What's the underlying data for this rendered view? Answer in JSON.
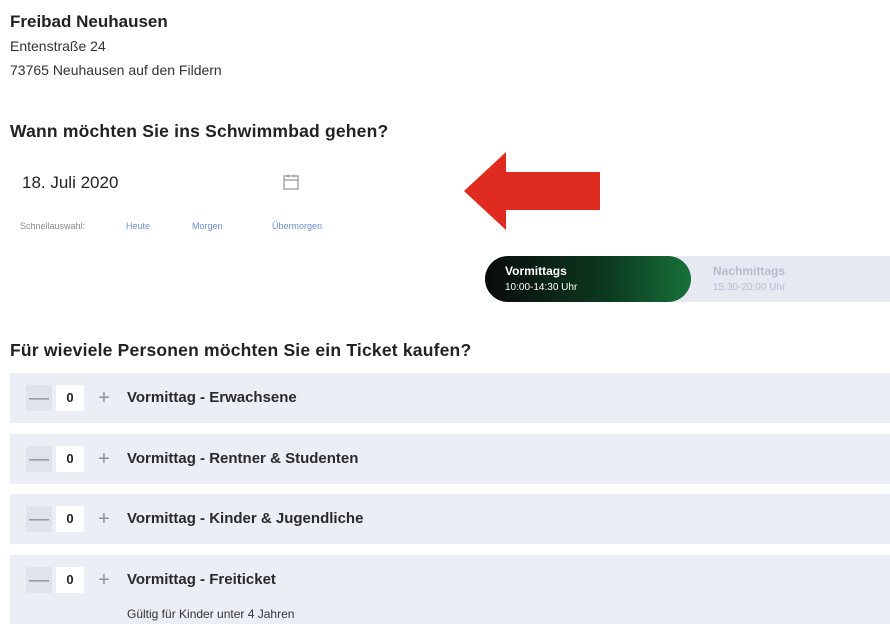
{
  "venue": {
    "name": "Freibad Neuhausen",
    "street": "Entenstraße 24",
    "city": "73765 Neuhausen auf den Fildern"
  },
  "date_section": {
    "question": "Wann möchten Sie ins Schwimmbad gehen?",
    "date_value": "18. Juli 2020",
    "icon": "calendar-icon",
    "quick_select_label": "Schnellauswahl:",
    "quick_options": [
      "Heute",
      "Morgen",
      "Übermorgen"
    ]
  },
  "annotation": {
    "arrow_color": "#e02b20"
  },
  "time_slots": [
    {
      "label": "Vormittags",
      "time": "10:00-14:30 Uhr",
      "selected": true
    },
    {
      "label": "Nachmittags",
      "time": "15:30-20:00 Uhr",
      "selected": false
    }
  ],
  "ticket_section": {
    "question": "Für wieviele Personen möchten Sie ein Ticket kaufen?",
    "minus_symbol": "—",
    "plus_symbol": "+",
    "tickets": [
      {
        "label": "Vormittag - Erwachsene",
        "quantity": "0"
      },
      {
        "label": "Vormittag - Rentner & Studenten",
        "quantity": "0"
      },
      {
        "label": "Vormittag - Kinder & Jugendliche",
        "quantity": "0"
      },
      {
        "label": "Vormittag - Freiticket",
        "quantity": "0",
        "note": "Gültig für Kinder unter 4 Jahren"
      }
    ]
  },
  "colors": {
    "selected_slot_gradient_end": "#17713a",
    "row_background": "#eceef6",
    "link": "#6d8fcf"
  }
}
